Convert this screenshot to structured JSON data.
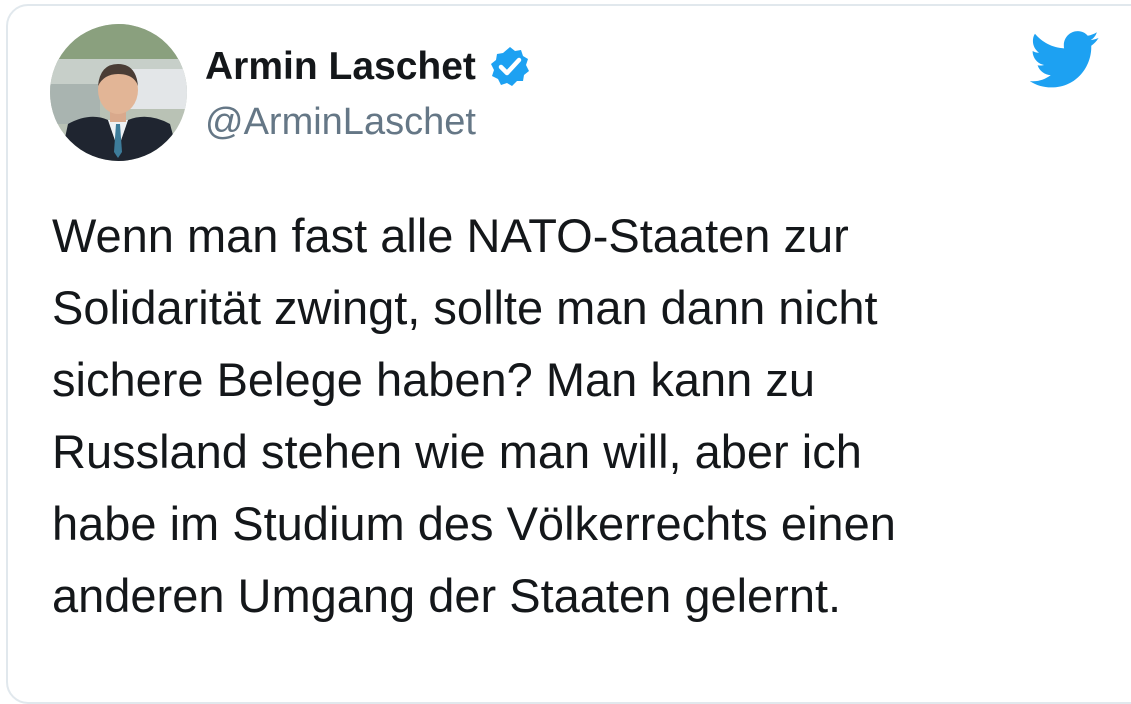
{
  "tweet": {
    "display_name": "Armin Laschet",
    "handle": "@ArminLaschet",
    "verified": true,
    "text": "Wenn man fast alle NATO-Staaten zur\nSolidarität zwingt, sollte man dann nicht\nsichere Belege haben? Man kann zu\nRussland stehen wie man will, aber ich\nhabe im Studium des Völkerrechts einen\nanderen Umgang der Staaten gelernt."
  },
  "icons": {
    "verified": "verified-badge-icon",
    "brand": "twitter-bird-icon"
  },
  "colors": {
    "brand": "#1da1f2",
    "name_text": "#14171a",
    "handle_text": "#657786",
    "border": "#e1e8ed"
  }
}
